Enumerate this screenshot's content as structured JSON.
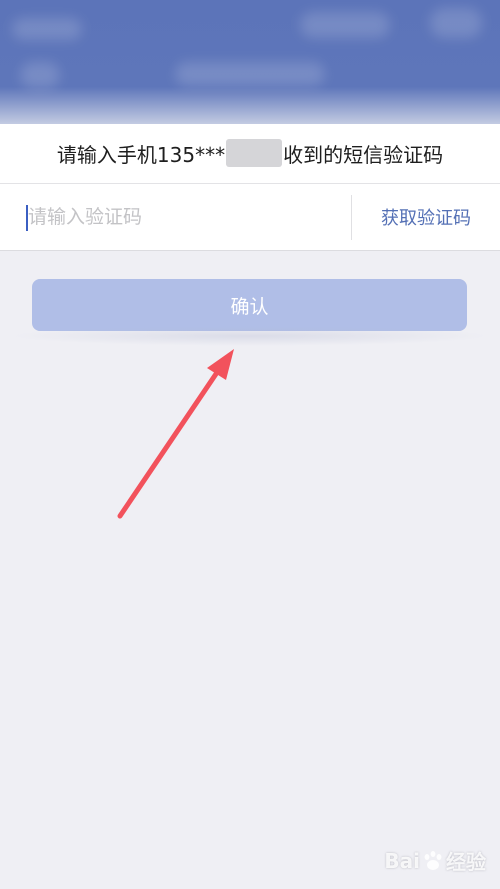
{
  "instruction": {
    "prefix": "请输入手机135***",
    "suffix": "收到的短信验证码"
  },
  "code_input": {
    "placeholder": "请输入验证码",
    "value": ""
  },
  "get_code_label": "获取验证码",
  "confirm_label": "确认",
  "watermark": {
    "left_text": "Bai",
    "right_text": "经验"
  },
  "colors": {
    "header": "#5c74b9",
    "confirm_button": "#b0bee7",
    "link_blue": "#5470b5",
    "arrow_red": "#f2525c"
  }
}
